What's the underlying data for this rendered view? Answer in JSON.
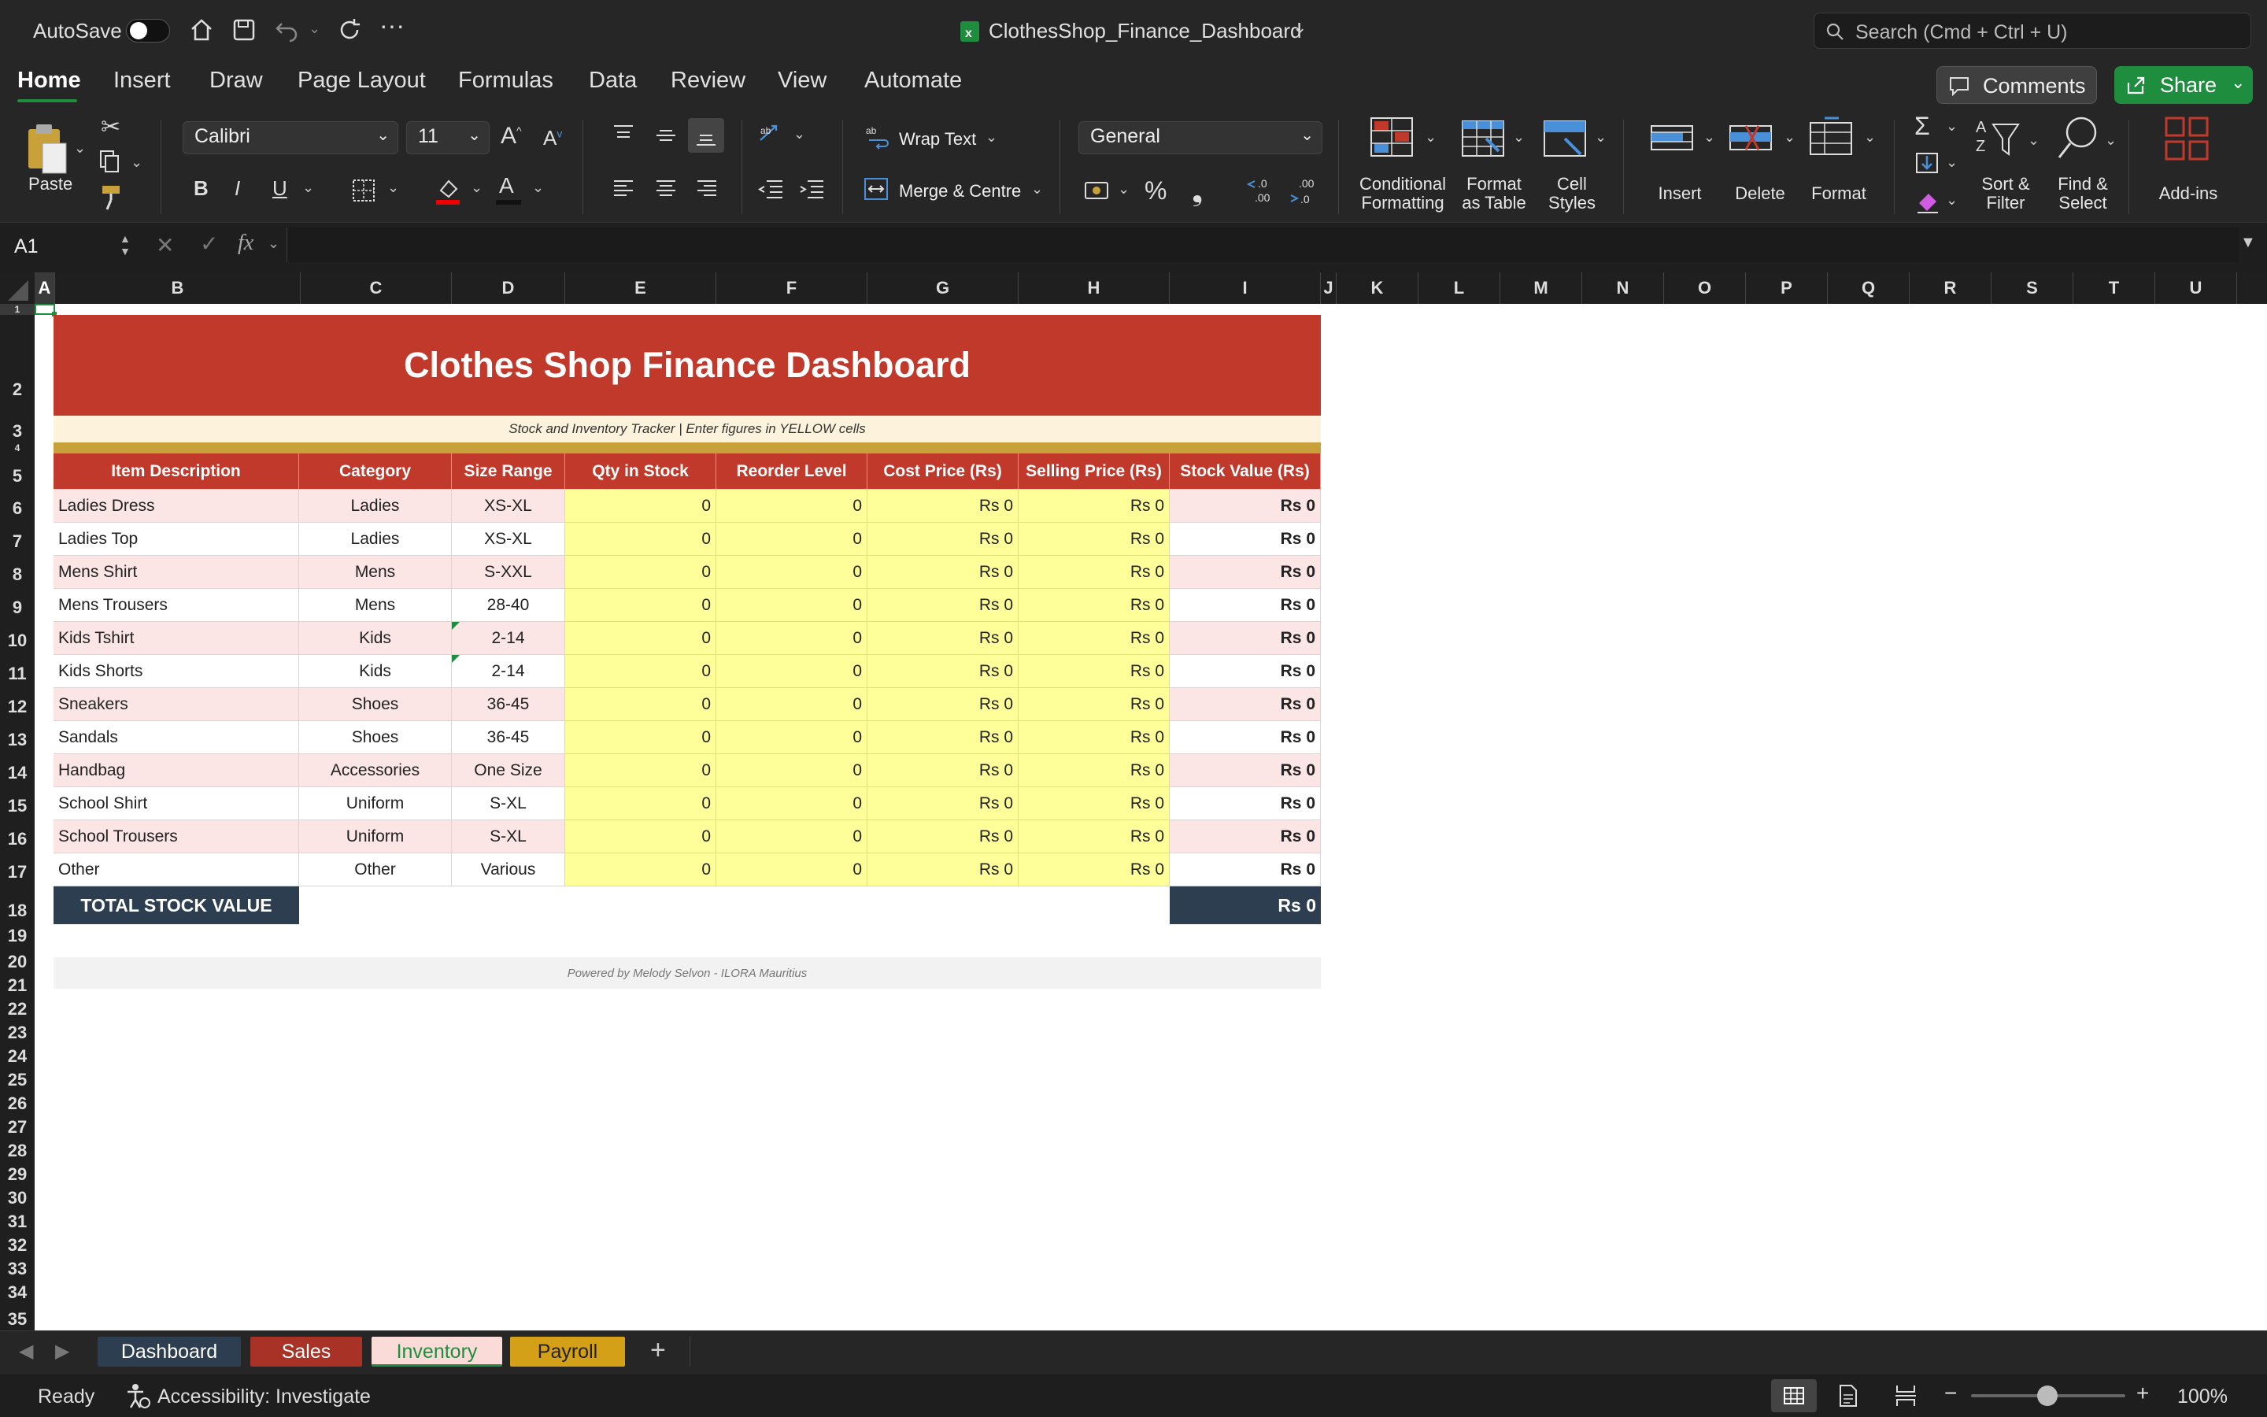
{
  "titlebar": {
    "autosave_label": "AutoSave",
    "file_name": "ClothesShop_Finance_Dashboard",
    "search_placeholder": "Search (Cmd + Ctrl + U)"
  },
  "menu_tabs": [
    "Home",
    "Insert",
    "Draw",
    "Page Layout",
    "Formulas",
    "Data",
    "Review",
    "View",
    "Automate"
  ],
  "actions": {
    "comments": "Comments",
    "share": "Share"
  },
  "ribbon": {
    "paste": "Paste",
    "font_name": "Calibri",
    "font_size": "11",
    "wrap_text": "Wrap Text",
    "merge_centre": "Merge & Centre",
    "number_format": "General",
    "conditional_1": "Conditional",
    "conditional_2": "Formatting",
    "format_table_1": "Format",
    "format_table_2": "as Table",
    "cell_styles_1": "Cell",
    "cell_styles_2": "Styles",
    "insert": "Insert",
    "delete": "Delete",
    "format": "Format",
    "sort_1": "Sort &",
    "sort_2": "Filter",
    "find_1": "Find &",
    "find_2": "Select",
    "addins": "Add-ins",
    "bold": "B",
    "italic": "I",
    "underline": "U",
    "font_color_glyph": "A",
    "percent": "%",
    "comma": "❟",
    "increase_font": "A",
    "decrease_font": "A"
  },
  "formula_bar": {
    "name_box": "A1",
    "fx": "fx",
    "formula": ""
  },
  "columns": [
    "A",
    "B",
    "C",
    "D",
    "E",
    "F",
    "G",
    "H",
    "I",
    "J",
    "K",
    "L",
    "M",
    "N",
    "O",
    "P",
    "Q",
    "R",
    "S",
    "T",
    "U"
  ],
  "rows": [
    "1",
    "2",
    "3",
    "4",
    "5",
    "6",
    "7",
    "8",
    "9",
    "10",
    "11",
    "12",
    "13",
    "14",
    "15",
    "16",
    "17",
    "18",
    "19",
    "20",
    "21",
    "22",
    "23",
    "24",
    "25",
    "26",
    "27",
    "28",
    "29",
    "30",
    "31",
    "32",
    "33",
    "34",
    "35"
  ],
  "sheet": {
    "title": "Clothes Shop Finance Dashboard",
    "subtitle": "Stock and Inventory Tracker  |  Enter figures in YELLOW cells",
    "headers": [
      "Item Description",
      "Category",
      "Size Range",
      "Qty in Stock",
      "Reorder Level",
      "Cost Price (Rs)",
      "Selling Price (Rs)",
      "Stock Value (Rs)"
    ],
    "items": [
      {
        "desc": "Ladies Dress",
        "cat": "Ladies",
        "size": "XS-XL",
        "qty": "0",
        "reorder": "0",
        "cost": "Rs 0",
        "sell": "Rs 0",
        "value": "Rs 0"
      },
      {
        "desc": "Ladies Top",
        "cat": "Ladies",
        "size": "XS-XL",
        "qty": "0",
        "reorder": "0",
        "cost": "Rs 0",
        "sell": "Rs 0",
        "value": "Rs 0"
      },
      {
        "desc": "Mens Shirt",
        "cat": "Mens",
        "size": "S-XXL",
        "qty": "0",
        "reorder": "0",
        "cost": "Rs 0",
        "sell": "Rs 0",
        "value": "Rs 0"
      },
      {
        "desc": "Mens Trousers",
        "cat": "Mens",
        "size": "28-40",
        "qty": "0",
        "reorder": "0",
        "cost": "Rs 0",
        "sell": "Rs 0",
        "value": "Rs 0"
      },
      {
        "desc": "Kids Tshirt",
        "cat": "Kids",
        "size": "2-14",
        "qty": "0",
        "reorder": "0",
        "cost": "Rs 0",
        "sell": "Rs 0",
        "value": "Rs 0"
      },
      {
        "desc": "Kids Shorts",
        "cat": "Kids",
        "size": "2-14",
        "qty": "0",
        "reorder": "0",
        "cost": "Rs 0",
        "sell": "Rs 0",
        "value": "Rs 0"
      },
      {
        "desc": "Sneakers",
        "cat": "Shoes",
        "size": "36-45",
        "qty": "0",
        "reorder": "0",
        "cost": "Rs 0",
        "sell": "Rs 0",
        "value": "Rs 0"
      },
      {
        "desc": "Sandals",
        "cat": "Shoes",
        "size": "36-45",
        "qty": "0",
        "reorder": "0",
        "cost": "Rs 0",
        "sell": "Rs 0",
        "value": "Rs 0"
      },
      {
        "desc": "Handbag",
        "cat": "Accessories",
        "size": "One Size",
        "qty": "0",
        "reorder": "0",
        "cost": "Rs 0",
        "sell": "Rs 0",
        "value": "Rs 0"
      },
      {
        "desc": "School Shirt",
        "cat": "Uniform",
        "size": "S-XL",
        "qty": "0",
        "reorder": "0",
        "cost": "Rs 0",
        "sell": "Rs 0",
        "value": "Rs 0"
      },
      {
        "desc": "School Trousers",
        "cat": "Uniform",
        "size": "S-XL",
        "qty": "0",
        "reorder": "0",
        "cost": "Rs 0",
        "sell": "Rs 0",
        "value": "Rs 0"
      },
      {
        "desc": "Other",
        "cat": "Other",
        "size": "Various",
        "qty": "0",
        "reorder": "0",
        "cost": "Rs 0",
        "sell": "Rs 0",
        "value": "Rs 0"
      }
    ],
    "total_label": "TOTAL STOCK VALUE",
    "total_value": "Rs 0",
    "footer": "Powered by Melody Selvon  -  ILORA Mauritius"
  },
  "sheet_tabs": [
    {
      "label": "Dashboard",
      "color": "#2c3e50"
    },
    {
      "label": "Sales",
      "color": "#a93226"
    },
    {
      "label": "Inventory",
      "color": "#fadbd8"
    },
    {
      "label": "Payroll",
      "color": "#d4a017"
    }
  ],
  "add_sheet": "+",
  "status": {
    "ready": "Ready",
    "accessibility": "Accessibility: Investigate",
    "zoom": "100%",
    "zoom_minus": "−",
    "zoom_plus": "+"
  },
  "colors": {
    "header_red": "#c0392b",
    "input_yellow": "#ffff99",
    "row_pink": "#fbe5e5",
    "total_navy": "#2c3e50",
    "banner_cream": "#fdf2dc",
    "gold_rule": "#c9a13b",
    "excel_green": "#1e8e3e"
  }
}
